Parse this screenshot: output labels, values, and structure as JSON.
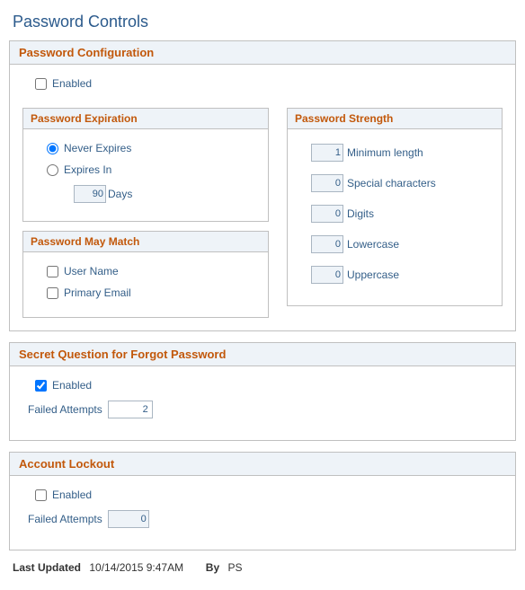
{
  "page_title": "Password Controls",
  "password_configuration": {
    "header": "Password Configuration",
    "enabled_label": "Enabled",
    "expiration": {
      "header": "Password Expiration",
      "never_label": "Never Expires",
      "expires_in_label": "Expires In",
      "days_value": "90",
      "days_unit": "Days"
    },
    "may_match": {
      "header": "Password May Match",
      "user_name_label": "User Name",
      "primary_email_label": "Primary Email"
    },
    "strength": {
      "header": "Password Strength",
      "min_length_value": "1",
      "min_length_label": "Minimum length",
      "special_value": "0",
      "special_label": "Special characters",
      "digits_value": "0",
      "digits_label": "Digits",
      "lowercase_value": "0",
      "lowercase_label": "Lowercase",
      "uppercase_value": "0",
      "uppercase_label": "Uppercase"
    }
  },
  "secret_question": {
    "header": "Secret Question for Forgot Password",
    "enabled_label": "Enabled",
    "failed_attempts_label": "Failed Attempts",
    "failed_attempts_value": "2"
  },
  "account_lockout": {
    "header": "Account Lockout",
    "enabled_label": "Enabled",
    "failed_attempts_label": "Failed Attempts",
    "failed_attempts_value": "0"
  },
  "footer": {
    "last_updated_label": "Last Updated",
    "last_updated_value": "10/14/2015  9:47AM",
    "by_label": "By",
    "by_value": "PS"
  }
}
